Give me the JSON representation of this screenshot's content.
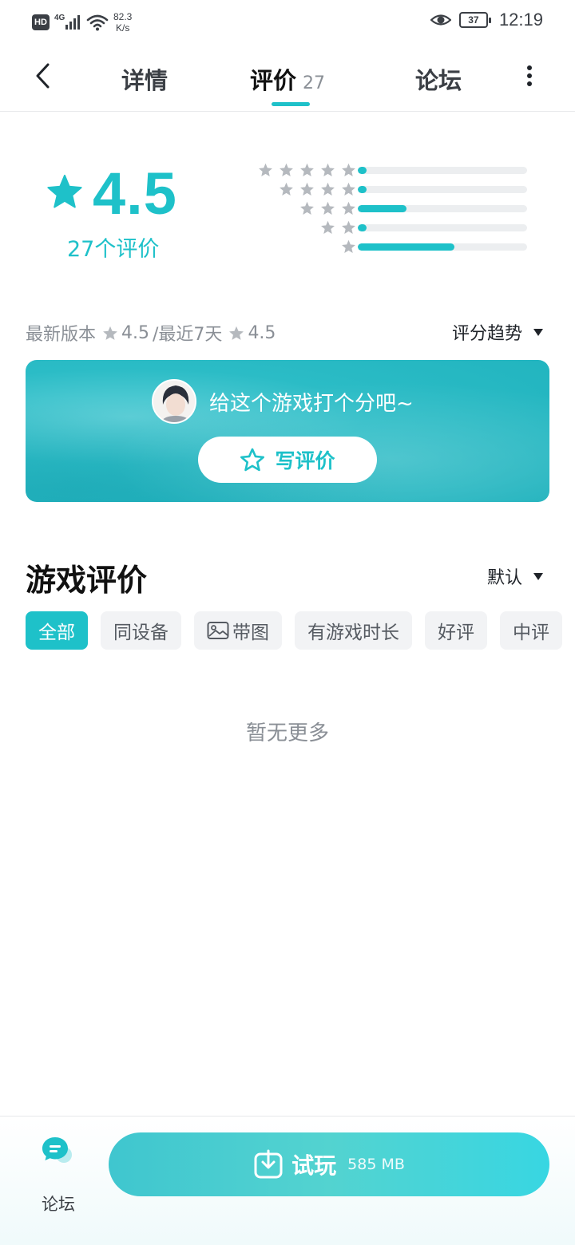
{
  "status_bar": {
    "hd": "HD",
    "network": "4G",
    "speed_value": "82.3",
    "speed_unit": "K/s",
    "battery": "37",
    "time": "12:19"
  },
  "nav": {
    "tabs": [
      {
        "label": "详情"
      },
      {
        "label": "评价",
        "count": "27",
        "active": true
      },
      {
        "label": "论坛"
      }
    ]
  },
  "rating": {
    "score": "4.5",
    "count_text": "27个评价",
    "distribution": [
      {
        "stars": 5,
        "fraction": 0.05
      },
      {
        "stars": 4,
        "fraction": 0.05
      },
      {
        "stars": 3,
        "fraction": 0.29
      },
      {
        "stars": 2,
        "fraction": 0.05
      },
      {
        "stars": 1,
        "fraction": 0.57
      }
    ]
  },
  "version_row": {
    "latest_label": "最新版本",
    "latest_score": "4.5",
    "recent_label": "/最近7天",
    "recent_score": "4.5",
    "trend_label": "评分趋势"
  },
  "write_card": {
    "prompt": "给这个游戏打个分吧~",
    "button_label": "写评价"
  },
  "reviews": {
    "title": "游戏评价",
    "sort_label": "默认",
    "filters": [
      {
        "label": "全部",
        "active": true
      },
      {
        "label": "同设备"
      },
      {
        "label": "带图",
        "icon": "image-icon"
      },
      {
        "label": "有游戏时长"
      },
      {
        "label": "好评"
      },
      {
        "label": "中评"
      }
    ],
    "empty_text": "暂无更多"
  },
  "bottom_bar": {
    "forum_label": "论坛",
    "play_label": "试玩",
    "play_size": "585 MB"
  },
  "colors": {
    "accent": "#1ec1c9",
    "text_primary": "#1f2329",
    "text_secondary": "#8a8f96",
    "chip_bg": "#f2f3f5"
  }
}
